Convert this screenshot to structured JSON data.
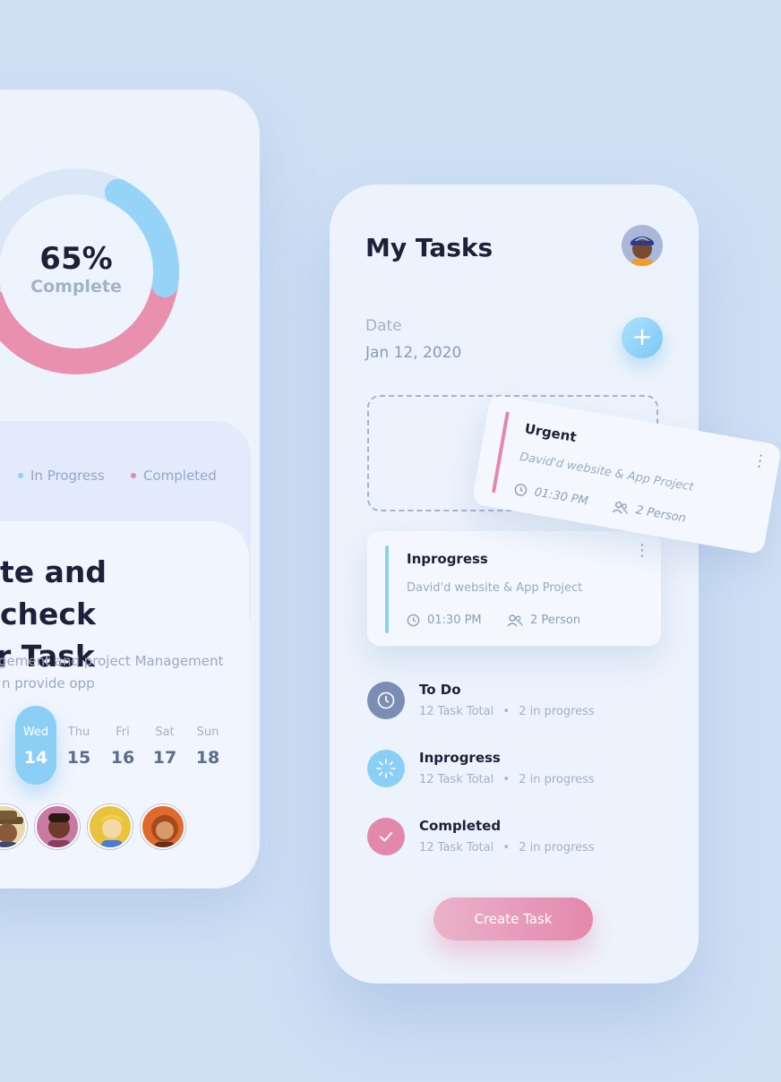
{
  "colors": {
    "background": "#cfe0f5",
    "in_progress": "#8ccff6",
    "completed": "#e488ab",
    "todo": "#7b8db3",
    "text_dark": "#1d2038"
  },
  "left_screen": {
    "progress": {
      "percent_label": "65%",
      "status_label": "Complete",
      "fraction_completed": 0.65
    },
    "legend": [
      {
        "label": "In Progress",
        "color": "#8ccff6"
      },
      {
        "label": "Completed",
        "color": "#e488ab"
      }
    ],
    "hero": {
      "title_line1": "te and check",
      "title_line2": "r Task",
      "desc_line1": "gement and project Management",
      "desc_line2": "n provide opp"
    },
    "days": [
      {
        "name": "Wed",
        "date": "14",
        "active": true
      },
      {
        "name": "Thu",
        "date": "15",
        "active": false
      },
      {
        "name": "Fri",
        "date": "16",
        "active": false
      },
      {
        "name": "Sat",
        "date": "17",
        "active": false
      },
      {
        "name": "Sun",
        "date": "18",
        "active": false
      }
    ],
    "avatars": [
      "avatar-hat",
      "avatar-pink",
      "avatar-yellow",
      "avatar-orange"
    ]
  },
  "right_screen": {
    "title": "My Tasks",
    "date_label": "Date",
    "date_value": "Jan 12, 2020",
    "add_icon": "plus-icon",
    "urgent_card": {
      "title": "Urgent",
      "subtitle": "David'd website & App Project",
      "time": "01:30 PM",
      "people": "2 Person"
    },
    "progress_card": {
      "title": "Inprogress",
      "subtitle": "David'd website & App Project",
      "time": "01:30 PM",
      "people": "2 Person"
    },
    "categories": [
      {
        "title": "To Do",
        "total": "12 Task Total",
        "progress": "2 in progress",
        "icon": "clock-icon"
      },
      {
        "title": "Inprogress",
        "total": "12 Task Total",
        "progress": "2 in progress",
        "icon": "loader-icon"
      },
      {
        "title": "Completed",
        "total": "12 Task Total",
        "progress": "2 in progress",
        "icon": "check-icon"
      }
    ],
    "create_button": "Create Task"
  }
}
